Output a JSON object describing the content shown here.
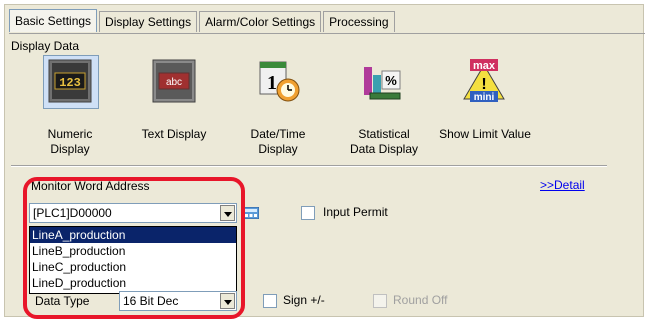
{
  "tabs": [
    "Basic Settings",
    "Display Settings",
    "Alarm/Color Settings",
    "Processing"
  ],
  "display_data": {
    "label": "Display Data",
    "items": [
      {
        "name": "Numeric Display",
        "line1": "Numeric",
        "line2": "Display",
        "icon": "numeric-display-icon"
      },
      {
        "name": "Text Display",
        "line1": "Text Display",
        "line2": "",
        "icon": "text-display-icon"
      },
      {
        "name": "Date/Time Display",
        "line1": "Date/Time",
        "line2": "Display",
        "icon": "date-time-icon"
      },
      {
        "name": "Statistical Data Display",
        "line1": "Statistical",
        "line2": "Data Display",
        "icon": "statistical-data-icon"
      },
      {
        "name": "Show Limit Value",
        "line1": "Show Limit Value",
        "line2": "",
        "icon": "limit-value-icon"
      }
    ]
  },
  "monitor": {
    "label": "Monitor Word Address",
    "detail_link": ">>Detail",
    "address_value": "[PLC1]D00000",
    "input_permit_label": "Input Permit",
    "dropdown_items": [
      "LineA_production",
      "LineB_production",
      "LineC_production",
      "LineD_production"
    ],
    "selected_index": 0
  },
  "data_type": {
    "label": "Data Type",
    "value": "16 Bit Dec",
    "sign_label": "Sign +/-",
    "round_off_label": "Round Off"
  },
  "colors": {
    "highlight": "#e8162a",
    "selection": "#0a246a",
    "link": "#0000ee"
  }
}
